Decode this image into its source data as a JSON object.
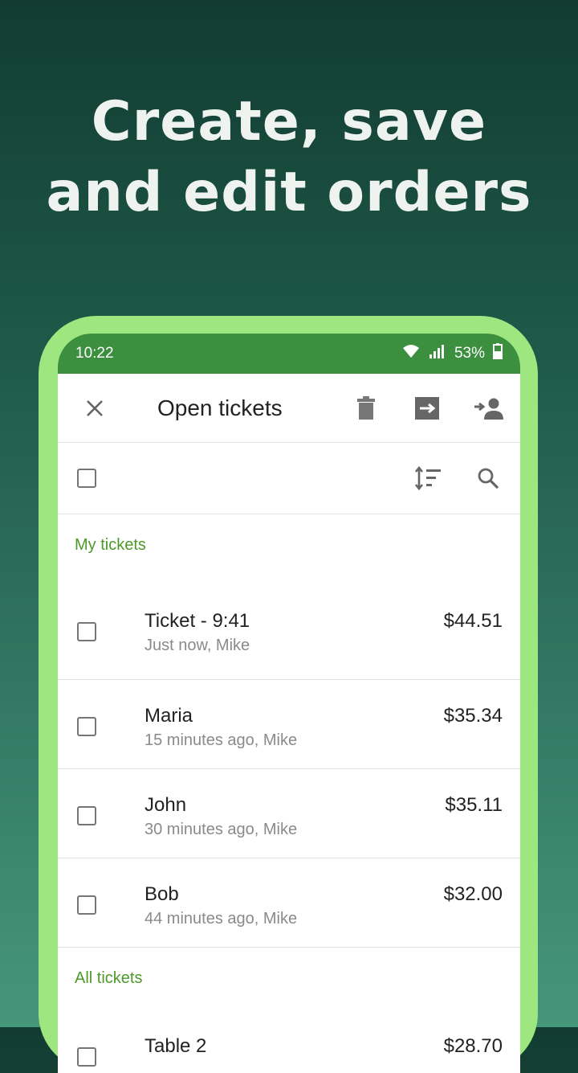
{
  "headline": {
    "line1": "Create, save",
    "line2": "and edit orders"
  },
  "status_bar": {
    "time": "10:22",
    "battery": "53%",
    "icons": [
      "wifi-icon",
      "signal-icon",
      "battery-icon"
    ]
  },
  "toolbar": {
    "title": "Open tickets",
    "icons": [
      "close-icon",
      "delete-icon",
      "move-icon",
      "assign-user-icon"
    ]
  },
  "filter_bar": {
    "icons": [
      "sort-icon",
      "search-icon"
    ]
  },
  "sections": [
    {
      "title": "My tickets",
      "tickets": [
        {
          "name": "Ticket - 9:41",
          "meta": "Just now, Mike",
          "amount": "$44.51"
        },
        {
          "name": "Maria",
          "meta": "15 minutes ago, Mike",
          "amount": "$35.34"
        },
        {
          "name": "John",
          "meta": "30 minutes ago, Mike",
          "amount": "$35.11"
        },
        {
          "name": "Bob",
          "meta": "44 minutes ago, Mike",
          "amount": "$32.00"
        }
      ]
    },
    {
      "title": "All tickets",
      "tickets": [
        {
          "name": "Table 2",
          "meta": "",
          "amount": "$28.70"
        }
      ]
    }
  ],
  "colors": {
    "accent_green": "#3b8f3f",
    "phone_frame": "#9ee67f",
    "section_header": "#4c9a2a"
  }
}
